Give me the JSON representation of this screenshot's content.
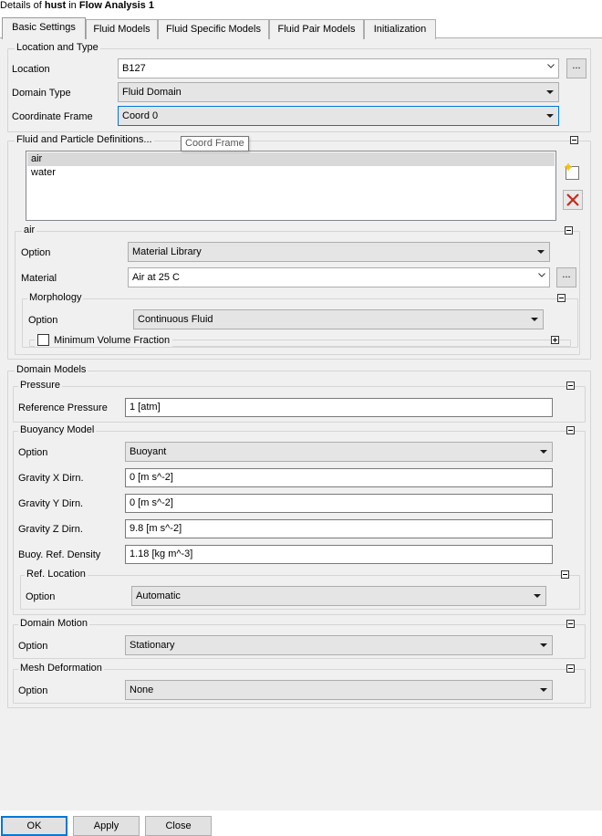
{
  "header": {
    "prefix": "Details of ",
    "object": "hust",
    "middle": " in ",
    "analysis": "Flow Analysis 1"
  },
  "tabs": [
    "Basic Settings",
    "Fluid Models",
    "Fluid Specific Models",
    "Fluid Pair Models",
    "Initialization"
  ],
  "location_type": {
    "title": "Location and Type",
    "location_label": "Location",
    "location_value": "B127",
    "location_button": "...",
    "domain_type_label": "Domain Type",
    "domain_type_value": "Fluid Domain",
    "coord_frame_label": "Coordinate Frame",
    "coord_frame_value": "Coord 0",
    "tooltip": "Coord Frame"
  },
  "fluid_defs": {
    "title": "Fluid and Particle Definitions...",
    "items": [
      "air",
      "water"
    ],
    "selected": "air"
  },
  "air": {
    "title": "air",
    "option_label": "Option",
    "option_value": "Material Library",
    "material_label": "Material",
    "material_value": "Air at 25 C",
    "material_button": "...",
    "morphology_title": "Morphology",
    "morph_option_label": "Option",
    "morph_option_value": "Continuous Fluid",
    "min_vol_label": "Minimum Volume Fraction"
  },
  "domain_models": {
    "title": "Domain Models",
    "pressure_title": "Pressure",
    "ref_pressure_label": "Reference Pressure",
    "ref_pressure_value": "1 [atm]",
    "buoyancy_title": "Buoyancy Model",
    "buoy_option_label": "Option",
    "buoy_option_value": "Buoyant",
    "gx_label": "Gravity X Dirn.",
    "gx_value": "0 [m s^-2]",
    "gy_label": "Gravity Y Dirn.",
    "gy_value": "0 [m s^-2]",
    "gz_label": "Gravity Z Dirn.",
    "gz_value": "9.8 [m s^-2]",
    "density_label": "Buoy. Ref. Density",
    "density_value": "1.18 [kg m^-3]",
    "ref_location_title": "Ref. Location",
    "ref_loc_option_label": "Option",
    "ref_loc_option_value": "Automatic",
    "motion_title": "Domain Motion",
    "motion_option_label": "Option",
    "motion_option_value": "Stationary",
    "mesh_title": "Mesh Deformation",
    "mesh_option_label": "Option",
    "mesh_option_value": "None"
  },
  "buttons": {
    "ok": "OK",
    "apply": "Apply",
    "close": "Close"
  },
  "colors": {
    "panel_bg": "#f0f0f0",
    "focus_blue": "#0078d7",
    "delete_red": "#c42b1c",
    "new_icon_yellow": "#f5c400"
  }
}
